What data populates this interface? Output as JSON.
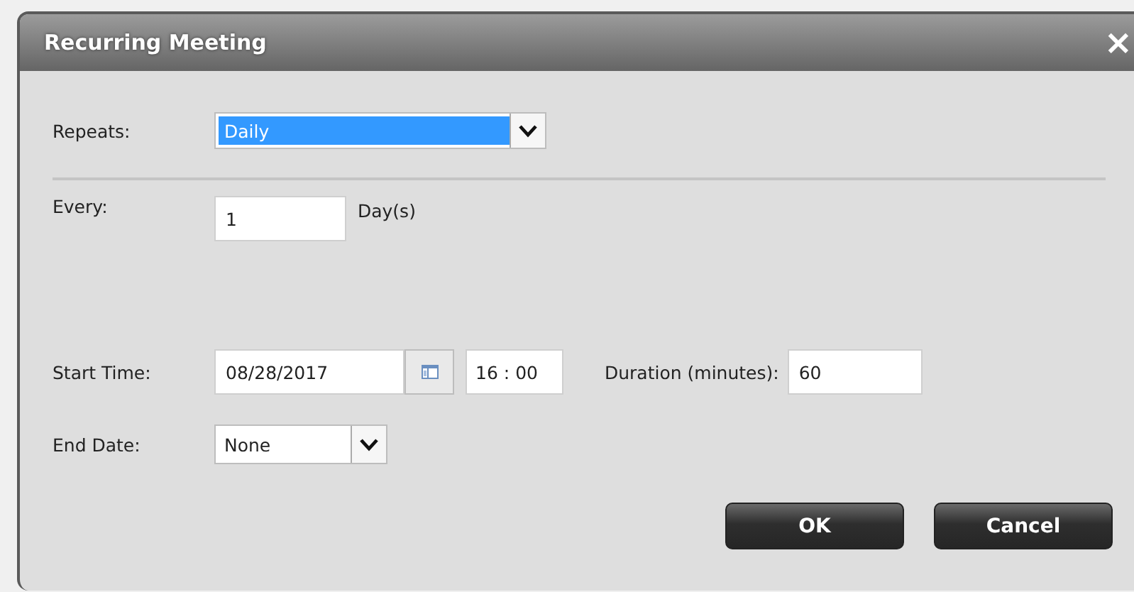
{
  "window": {
    "title": "Recurring Meeting",
    "close": "×"
  },
  "repeats": {
    "label": "Repeats:",
    "value": "Daily",
    "focused": true
  },
  "every": {
    "label": "Every:",
    "value": "1",
    "unit": "Day(s)"
  },
  "start_time": {
    "label": "Start Time:",
    "date": "08/28/2017",
    "time": "16 : 00"
  },
  "duration": {
    "label": "Duration (minutes):",
    "value": "60"
  },
  "end_date": {
    "label": "End Date:",
    "value": "None",
    "focused": false
  },
  "buttons": [
    "OK",
    "Cancel"
  ]
}
